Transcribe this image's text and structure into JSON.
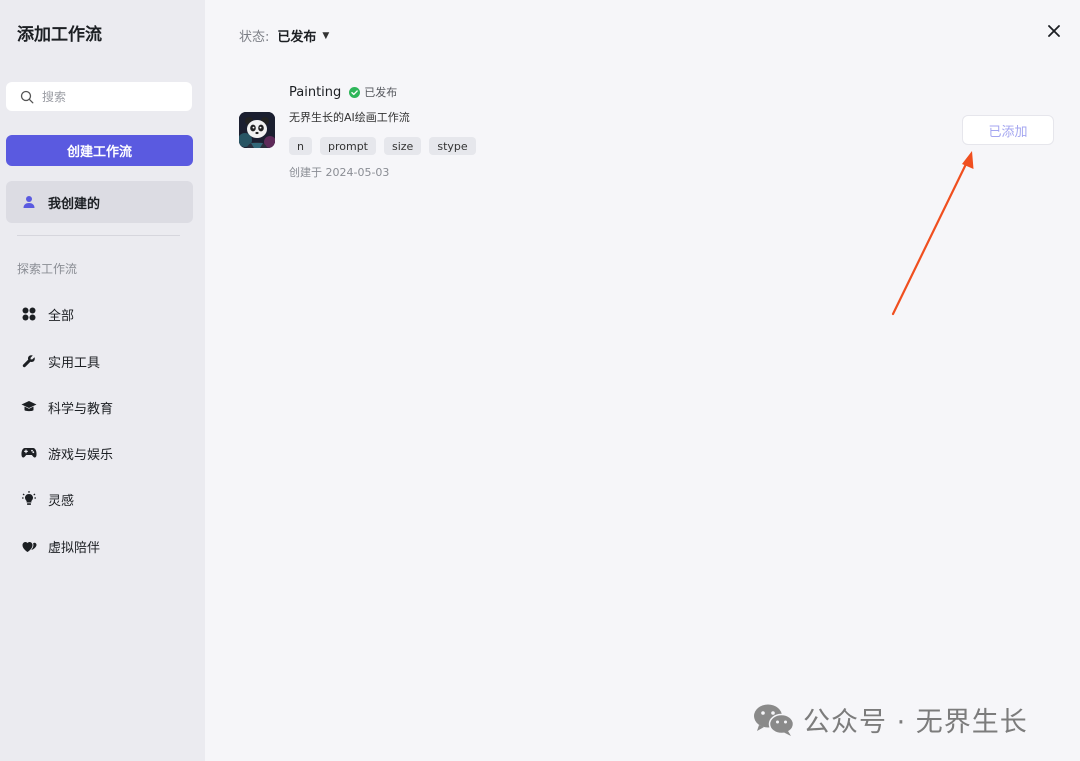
{
  "sidebar": {
    "title": "添加工作流",
    "search_placeholder": "搜索",
    "create_button": "创建工作流",
    "my_created": "我创建的",
    "explore_label": "探索工作流",
    "nav": [
      {
        "label": "全部",
        "icon": "grid-icon"
      },
      {
        "label": "实用工具",
        "icon": "wrench-icon"
      },
      {
        "label": "科学与教育",
        "icon": "graduation-cap-icon"
      },
      {
        "label": "游戏与娱乐",
        "icon": "gamepad-icon"
      },
      {
        "label": "灵感",
        "icon": "lightbulb-icon"
      },
      {
        "label": "虚拟陪伴",
        "icon": "hearts-icon"
      }
    ]
  },
  "main": {
    "status_label": "状态:",
    "status_value": "已发布",
    "workflow": {
      "name": "Painting",
      "status": "已发布",
      "description": "无界生长的AI绘画工作流",
      "params": [
        "n",
        "prompt",
        "size",
        "stype"
      ],
      "created": "创建于 2024-05-03",
      "action": "已添加"
    }
  },
  "watermark": "公众号 · 无界生长",
  "colors": {
    "accent": "#5a5ae0",
    "published_green": "#2fb65a",
    "arrow": "#f04f1f",
    "added_text": "#a4a6f0"
  }
}
